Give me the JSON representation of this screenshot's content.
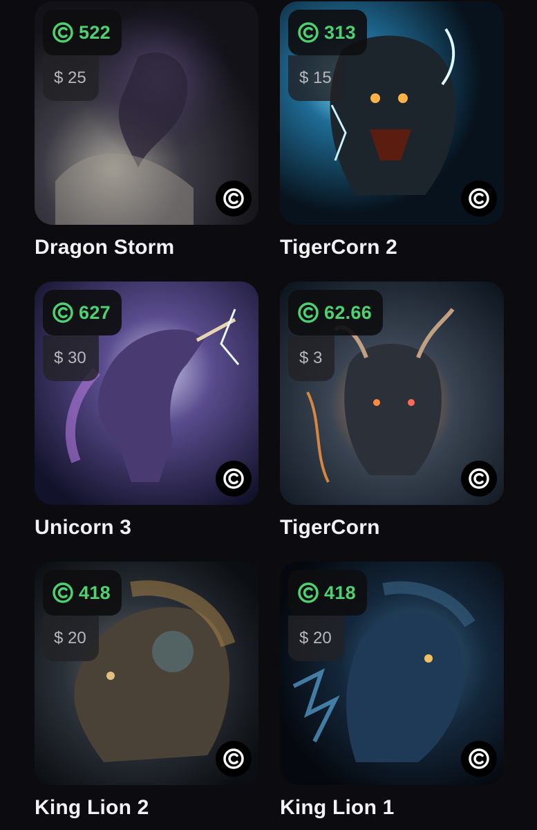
{
  "currency_icon": "c-coin-icon",
  "copyright_icon": "copyright-icon",
  "colors": {
    "background": "#0c0b10",
    "coin_value": "#4ed16f",
    "usd_text": "#b8b8bf",
    "title_text": "#f2f2f5"
  },
  "items": [
    {
      "title": "Dragon Storm",
      "coins": "522",
      "usd": "$ 25"
    },
    {
      "title": "TigerCorn 2",
      "coins": "313",
      "usd": "$ 15"
    },
    {
      "title": "Unicorn 3",
      "coins": "627",
      "usd": "$ 30"
    },
    {
      "title": "TigerCorn",
      "coins": "62.66",
      "usd": "$ 3"
    },
    {
      "title": "King Lion 2",
      "coins": "418",
      "usd": "$ 20"
    },
    {
      "title": "King Lion 1",
      "coins": "418",
      "usd": "$ 20"
    }
  ]
}
